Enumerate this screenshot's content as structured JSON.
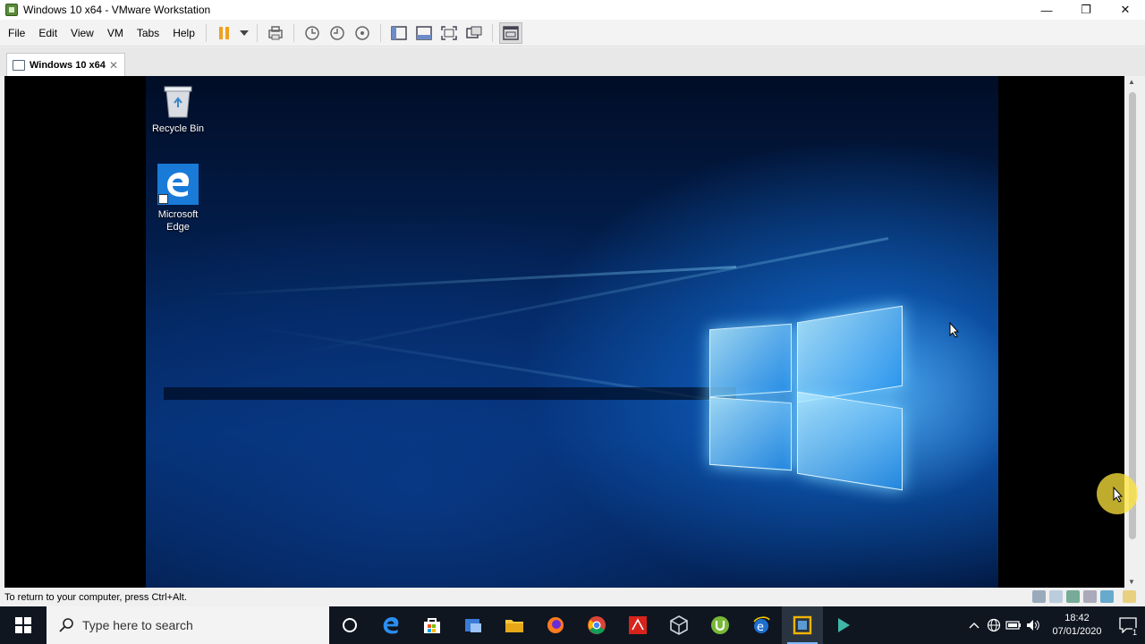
{
  "window": {
    "title": "Windows 10 x64 - VMware Workstation",
    "controls": {
      "minimize": "—",
      "restore": "❐",
      "close": "✕"
    }
  },
  "menu": [
    "File",
    "Edit",
    "View",
    "VM",
    "Tabs",
    "Help"
  ],
  "toolbar_icons": [
    "pause-icon",
    "dropdown-icon",
    "send-ctrl-alt-del-icon",
    "snapshot-icon",
    "revert-snapshot-icon",
    "snapshot-manager-icon",
    "library-icon",
    "thumbnail-bar-icon",
    "full-screen-icon",
    "unity-icon",
    "console-view-icon"
  ],
  "tab": {
    "label": "Windows 10 x64",
    "close": "✕"
  },
  "desktop": {
    "icons": [
      {
        "label": "Recycle Bin"
      },
      {
        "label_line1": "Microsoft",
        "label_line2": "Edge"
      }
    ]
  },
  "status": {
    "text": "To return to your computer, press Ctrl+Alt."
  },
  "taskbar": {
    "search_placeholder": "Type here to search",
    "apps": [
      "cortana-icon",
      "edge-icon",
      "store-icon",
      "explorer-manager-icon",
      "file-explorer-icon",
      "firefox-icon",
      "chrome-icon",
      "acrobat-icon",
      "virtualbox-icon",
      "utorrent-icon",
      "ie-icon",
      "vmware-icon",
      "media-icon"
    ],
    "clock": {
      "time": "18:42",
      "date": "07/01/2020"
    },
    "notification_count": "1"
  },
  "colors": {
    "accent": "#1a7ad8",
    "taskbar": "#0f1620",
    "vm_background": "#000000"
  }
}
